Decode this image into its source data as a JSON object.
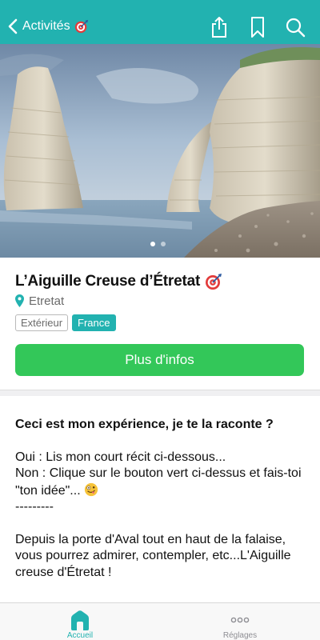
{
  "header": {
    "back_label": "Activités",
    "icons": [
      "dart-emoji-icon",
      "share-icon",
      "bookmark-icon",
      "search-icon"
    ]
  },
  "carousel": {
    "image": "cliffs-etretat-photo",
    "page_count": 2,
    "active_page": 1
  },
  "activity": {
    "title": "L’Aiguille Creuse d’Étretat",
    "location": "Etretat",
    "tags": [
      "Extérieur",
      "France"
    ],
    "cta_label": "Plus d'infos"
  },
  "description": {
    "heading": "Ceci est mon expérience, je te la raconte ?",
    "line_oui": "Oui : Lis mon court récit ci-dessous...",
    "line_non": "Non : Clique sur le bouton vert ci-dessus et fais-toi \"ton idée\"...",
    "divider": "---------",
    "body": "Depuis la porte d'Aval tout en haut de la falaise, vous pourrez admirer, contempler, etc...L'Aiguille creuse d'Étretat !"
  },
  "tabbar": {
    "tabs": [
      {
        "label": "Accueil",
        "icon": "home-icon",
        "active": true
      },
      {
        "label": "Réglages",
        "icon": "more-dots-icon",
        "active": false
      }
    ]
  },
  "colors": {
    "accent": "#22b2b0",
    "cta": "#33c759",
    "tag_fill": "#22b2b0"
  }
}
